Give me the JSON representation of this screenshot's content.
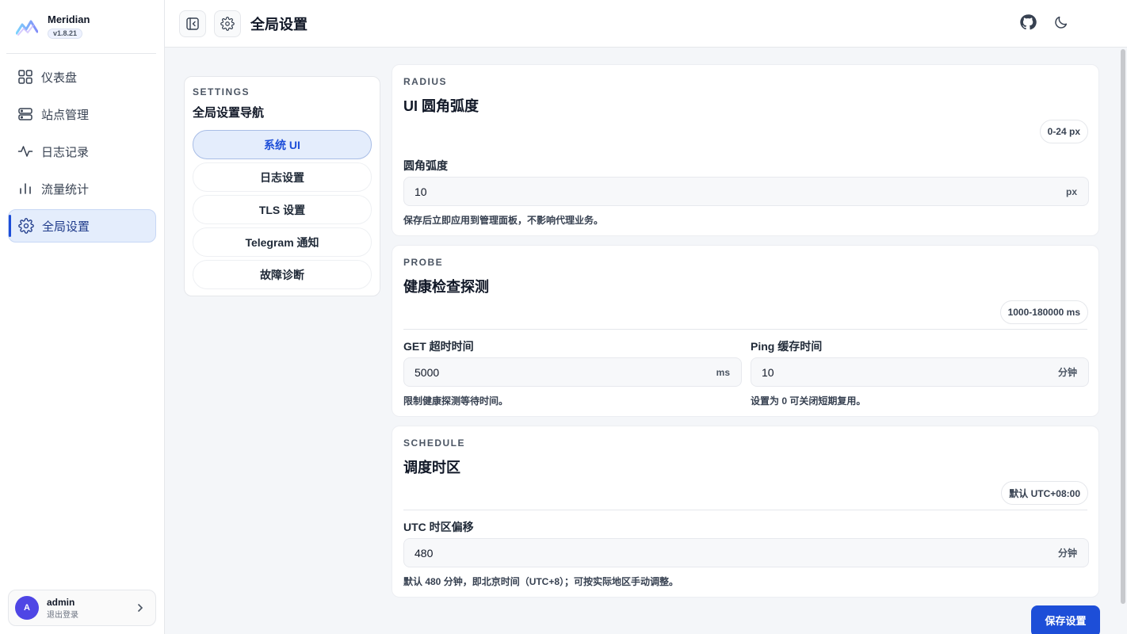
{
  "brand": {
    "name": "Meridian",
    "version": "v1.8.21"
  },
  "sidebar": {
    "items": [
      {
        "label": "仪表盘",
        "icon": "dashboard-grid-icon"
      },
      {
        "label": "站点管理",
        "icon": "server-icon"
      },
      {
        "label": "日志记录",
        "icon": "activity-icon"
      },
      {
        "label": "流量统计",
        "icon": "bar-chart-icon"
      },
      {
        "label": "全局设置",
        "icon": "gear-icon",
        "active": true
      }
    ]
  },
  "user": {
    "initial": "A",
    "name": "admin",
    "action": "退出登录"
  },
  "header": {
    "title": "全局设置"
  },
  "settings_nav": {
    "kicker": "SETTINGS",
    "title": "全局设置导航",
    "items": [
      "系统 UI",
      "日志设置",
      "TLS 设置",
      "Telegram 通知",
      "故障诊断"
    ],
    "active_index": 0
  },
  "radius_card": {
    "kicker": "RADIUS",
    "title": "UI 圆角弧度",
    "badge": "0-24 px",
    "field_label": "圆角弧度",
    "value": "10",
    "unit": "px",
    "help": "保存后立即应用到管理面板，不影响代理业务。"
  },
  "probe_card": {
    "kicker": "PROBE",
    "title": "健康检查探测",
    "badge": "1000-180000 ms",
    "get_label": "GET 超时时间",
    "get_value": "5000",
    "get_unit": "ms",
    "get_help": "限制健康探测等待时间。",
    "ping_label": "Ping 缓存时间",
    "ping_value": "10",
    "ping_unit": "分钟",
    "ping_help": "设置为 0 可关闭短期复用。"
  },
  "schedule_card": {
    "kicker": "SCHEDULE",
    "title": "调度时区",
    "badge": "默认 UTC+08:00",
    "field_label": "UTC 时区偏移",
    "value": "480",
    "unit": "分钟",
    "help": "默认 480 分钟，即北京时间（UTC+8）；可按实际地区手动调整。"
  },
  "save_label": "保存设置",
  "colors": {
    "accent": "#1d4ed8",
    "active_bg": "#e4edfc",
    "avatar": "#4f46e5"
  }
}
